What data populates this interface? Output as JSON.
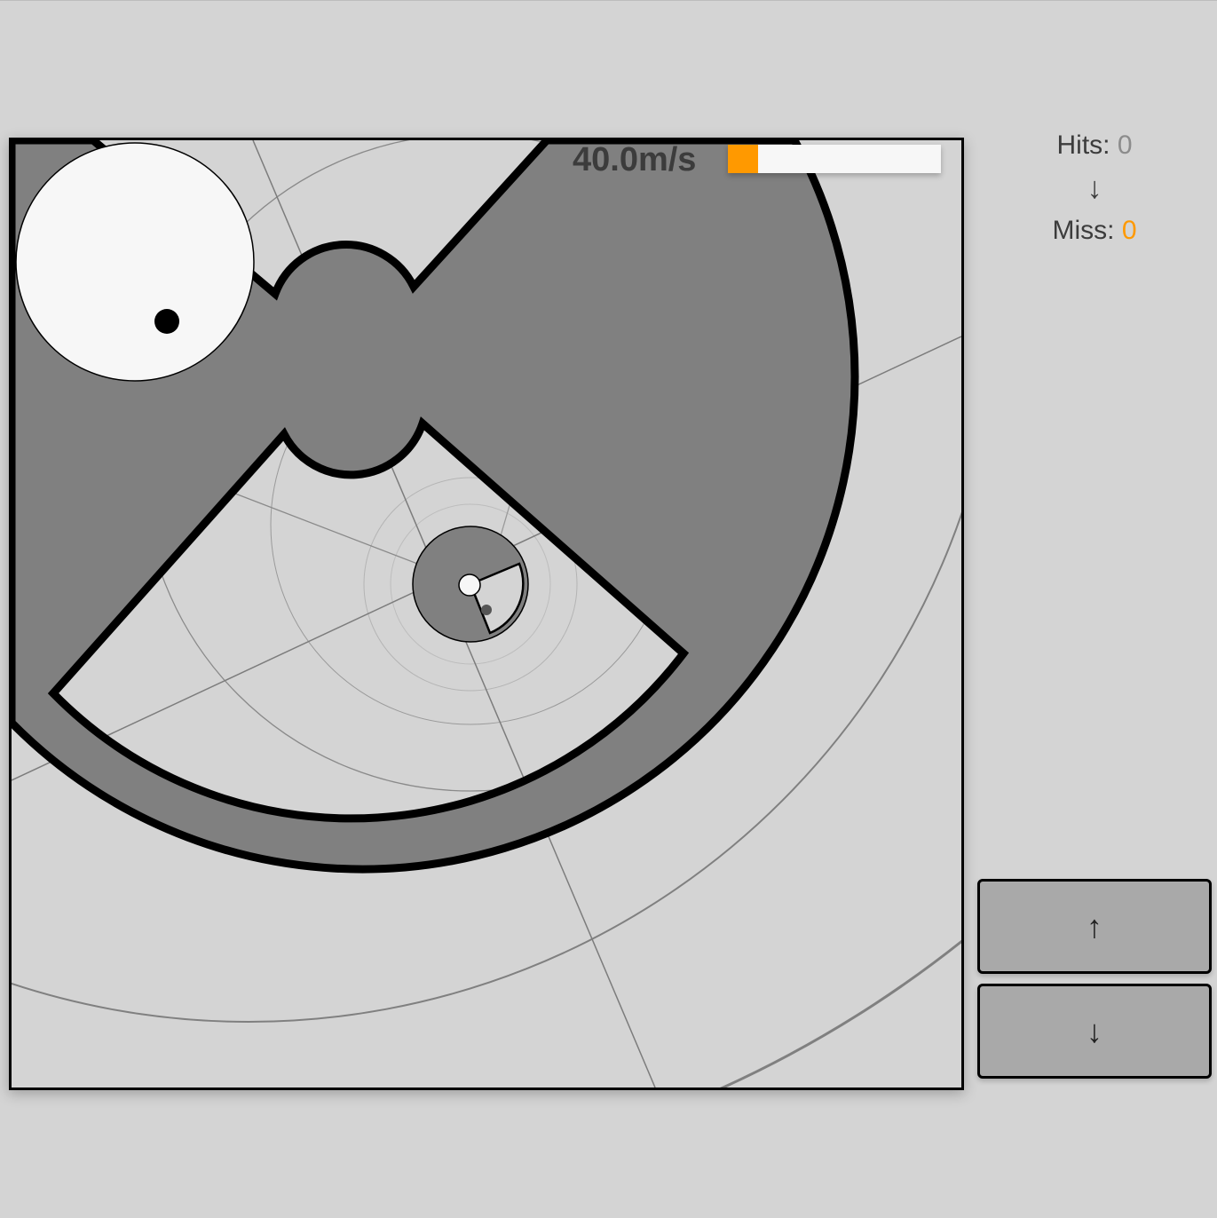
{
  "hud": {
    "speed": "40.0m/s",
    "speed_fraction": 0.14
  },
  "score": {
    "hits_label": "Hits: ",
    "hits_value": "0",
    "arrow": "↓",
    "miss_label": "Miss: ",
    "miss_value": "0"
  },
  "controls": {
    "up_label": "↑",
    "down_label": "↓"
  },
  "colors": {
    "accent": "#ff9900",
    "wheel": "#808080",
    "background": "#d4d4d4",
    "disc": "#f7f7f7"
  }
}
